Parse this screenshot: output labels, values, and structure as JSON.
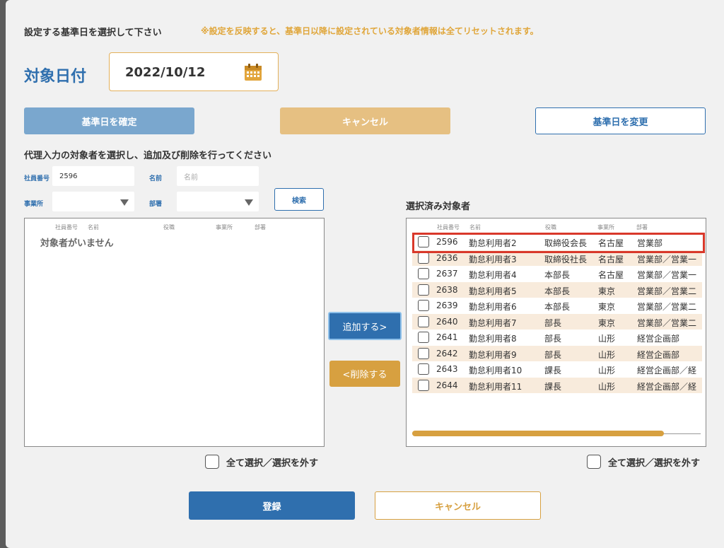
{
  "header": {
    "instruction": "設定する基準日を選択して下さい",
    "warning": "※設定を反映すると、基準日以降に設定されている対象者情報は全てリセットされます。"
  },
  "date": {
    "label": "対象日付",
    "value": "2022/10/12",
    "icon": "calendar-icon"
  },
  "buttons": {
    "confirm_base_date": "基準日を確定",
    "cancel_top": "キャンセル",
    "change_base_date": "基準日を変更",
    "search": "検索",
    "add": "追加する>",
    "remove": "<削除する",
    "register": "登録",
    "cancel_bottom": "キャンセル"
  },
  "search_section": {
    "title": "代理入力の対象者を選択し、追加及び削除を行ってください",
    "employee_no_label": "社員番号",
    "employee_no_value": "2596",
    "name_label": "名前",
    "name_placeholder": "名前",
    "office_label": "事業所",
    "office_value": "",
    "dept_label": "部署",
    "dept_value": ""
  },
  "left_table": {
    "headers": [
      "社員番号",
      "名前",
      "役職",
      "事業所",
      "部署"
    ],
    "empty_message": "対象者がいません"
  },
  "right_table": {
    "title": "選択済み対象者",
    "headers": [
      "社員番号",
      "名前",
      "役職",
      "事業所",
      "部署"
    ],
    "rows": [
      {
        "no": "2596",
        "name": "勤怠利用者2",
        "position": "取締役会長",
        "office": "名古屋",
        "dept": "営業部"
      },
      {
        "no": "2636",
        "name": "勤怠利用者3",
        "position": "取締役社長",
        "office": "名古屋",
        "dept": "営業部／営業一"
      },
      {
        "no": "2637",
        "name": "勤怠利用者4",
        "position": "本部長",
        "office": "名古屋",
        "dept": "営業部／営業一"
      },
      {
        "no": "2638",
        "name": "勤怠利用者5",
        "position": "本部長",
        "office": "東京",
        "dept": "営業部／営業二"
      },
      {
        "no": "2639",
        "name": "勤怠利用者6",
        "position": "本部長",
        "office": "東京",
        "dept": "営業部／営業二"
      },
      {
        "no": "2640",
        "name": "勤怠利用者7",
        "position": "部長",
        "office": "東京",
        "dept": "営業部／営業二"
      },
      {
        "no": "2641",
        "name": "勤怠利用者8",
        "position": "部長",
        "office": "山形",
        "dept": "経営企画部"
      },
      {
        "no": "2642",
        "name": "勤怠利用者9",
        "position": "部長",
        "office": "山形",
        "dept": "経営企画部"
      },
      {
        "no": "2643",
        "name": "勤怠利用者10",
        "position": "課長",
        "office": "山形",
        "dept": "経営企画部／経"
      },
      {
        "no": "2644",
        "name": "勤怠利用者11",
        "position": "課長",
        "office": "山形",
        "dept": "経営企画部／経"
      }
    ]
  },
  "select_all_label": "全て選択／選択を外す",
  "colors": {
    "primary": "#2f6fae",
    "accent": "#d7a040",
    "highlight": "#d9382a"
  }
}
